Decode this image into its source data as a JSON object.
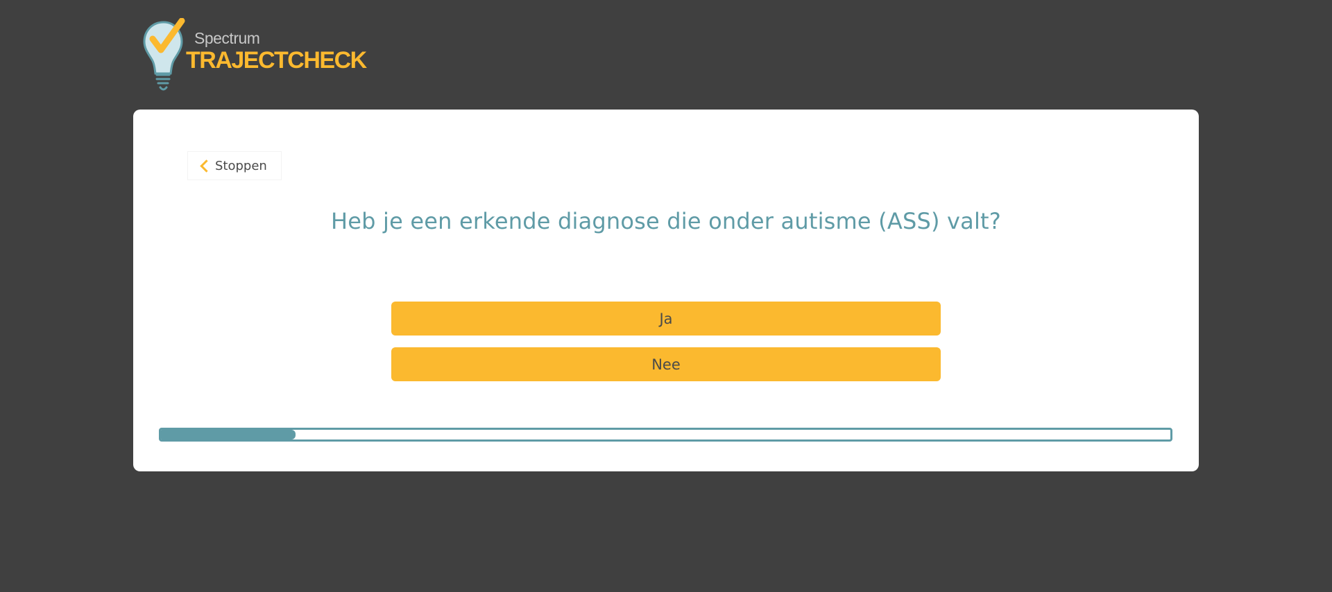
{
  "logo": {
    "spectrum": "Spectrum",
    "main": "TRAJECTCHECK",
    "icon": "lightbulb-check-icon"
  },
  "nav": {
    "stop_label": "Stoppen",
    "stop_icon": "chevron-left-icon"
  },
  "question": {
    "text": "Heb je een erkende diagnose die onder autisme (ASS) valt?"
  },
  "answers": [
    {
      "label": "Ja"
    },
    {
      "label": "Nee"
    }
  ],
  "progress": {
    "fraction": 0.133
  },
  "colors": {
    "background": "#404040",
    "card": "#ffffff",
    "accent": "#fbb92f",
    "teal": "#5f9ba6",
    "text": "#4a4a4a"
  }
}
